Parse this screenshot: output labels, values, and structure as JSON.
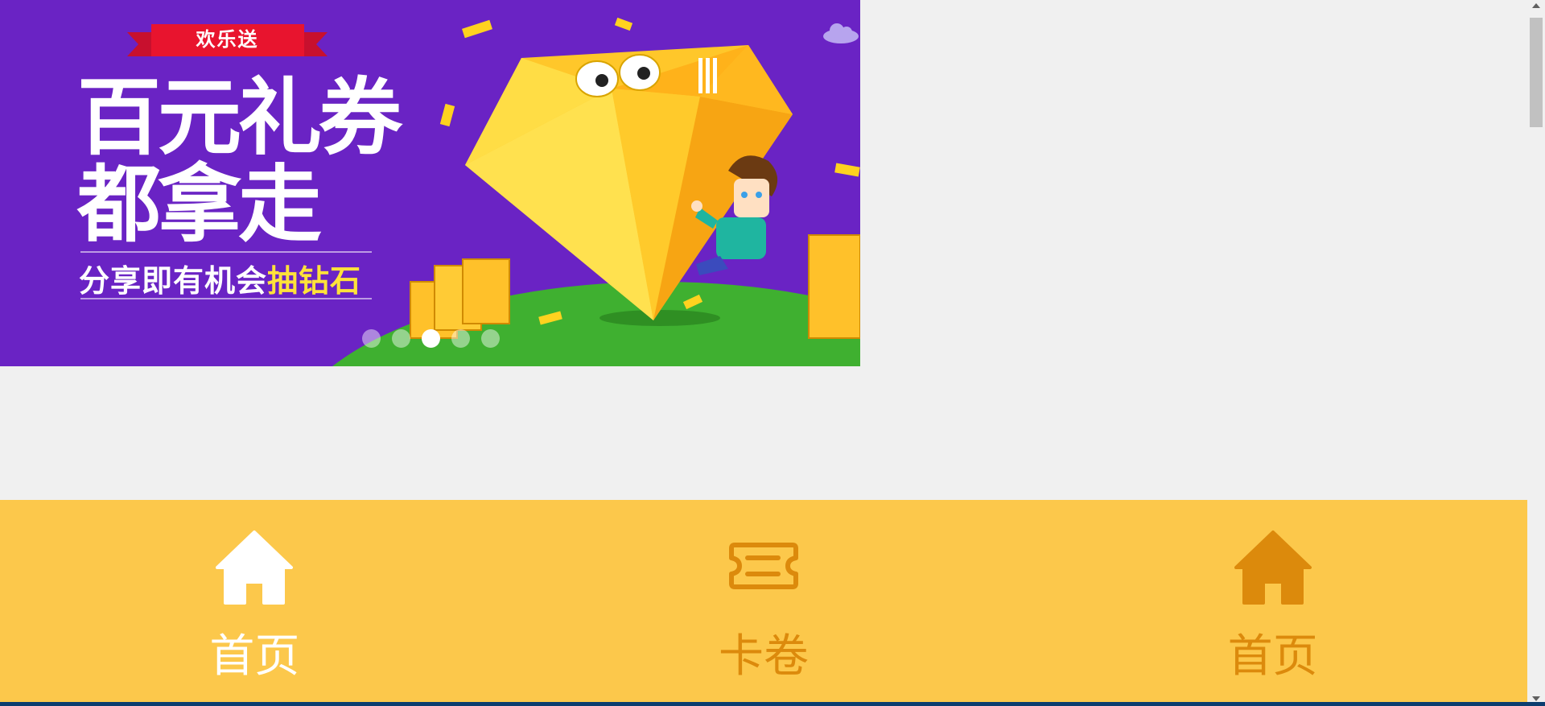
{
  "banner": {
    "ribbon_text": "欢乐送",
    "headline_line1": "百元礼券",
    "headline_line2": "都拿走",
    "subline_main": "分享即有机会",
    "subline_highlight": "抽钻石",
    "slide_count": 5,
    "active_slide": 3,
    "colors": {
      "background": "#6a23c4",
      "ground": "#3fb030",
      "diamond": "#ffc72a",
      "highlight_text": "#ffe23a"
    }
  },
  "tabbar": {
    "background": "#fcc84b",
    "tabs": [
      {
        "label": "首页",
        "icon": "home-icon",
        "active": true
      },
      {
        "label": "卡卷",
        "icon": "ticket-icon",
        "active": false
      },
      {
        "label": "首页",
        "icon": "home-icon",
        "active": false
      }
    ]
  }
}
